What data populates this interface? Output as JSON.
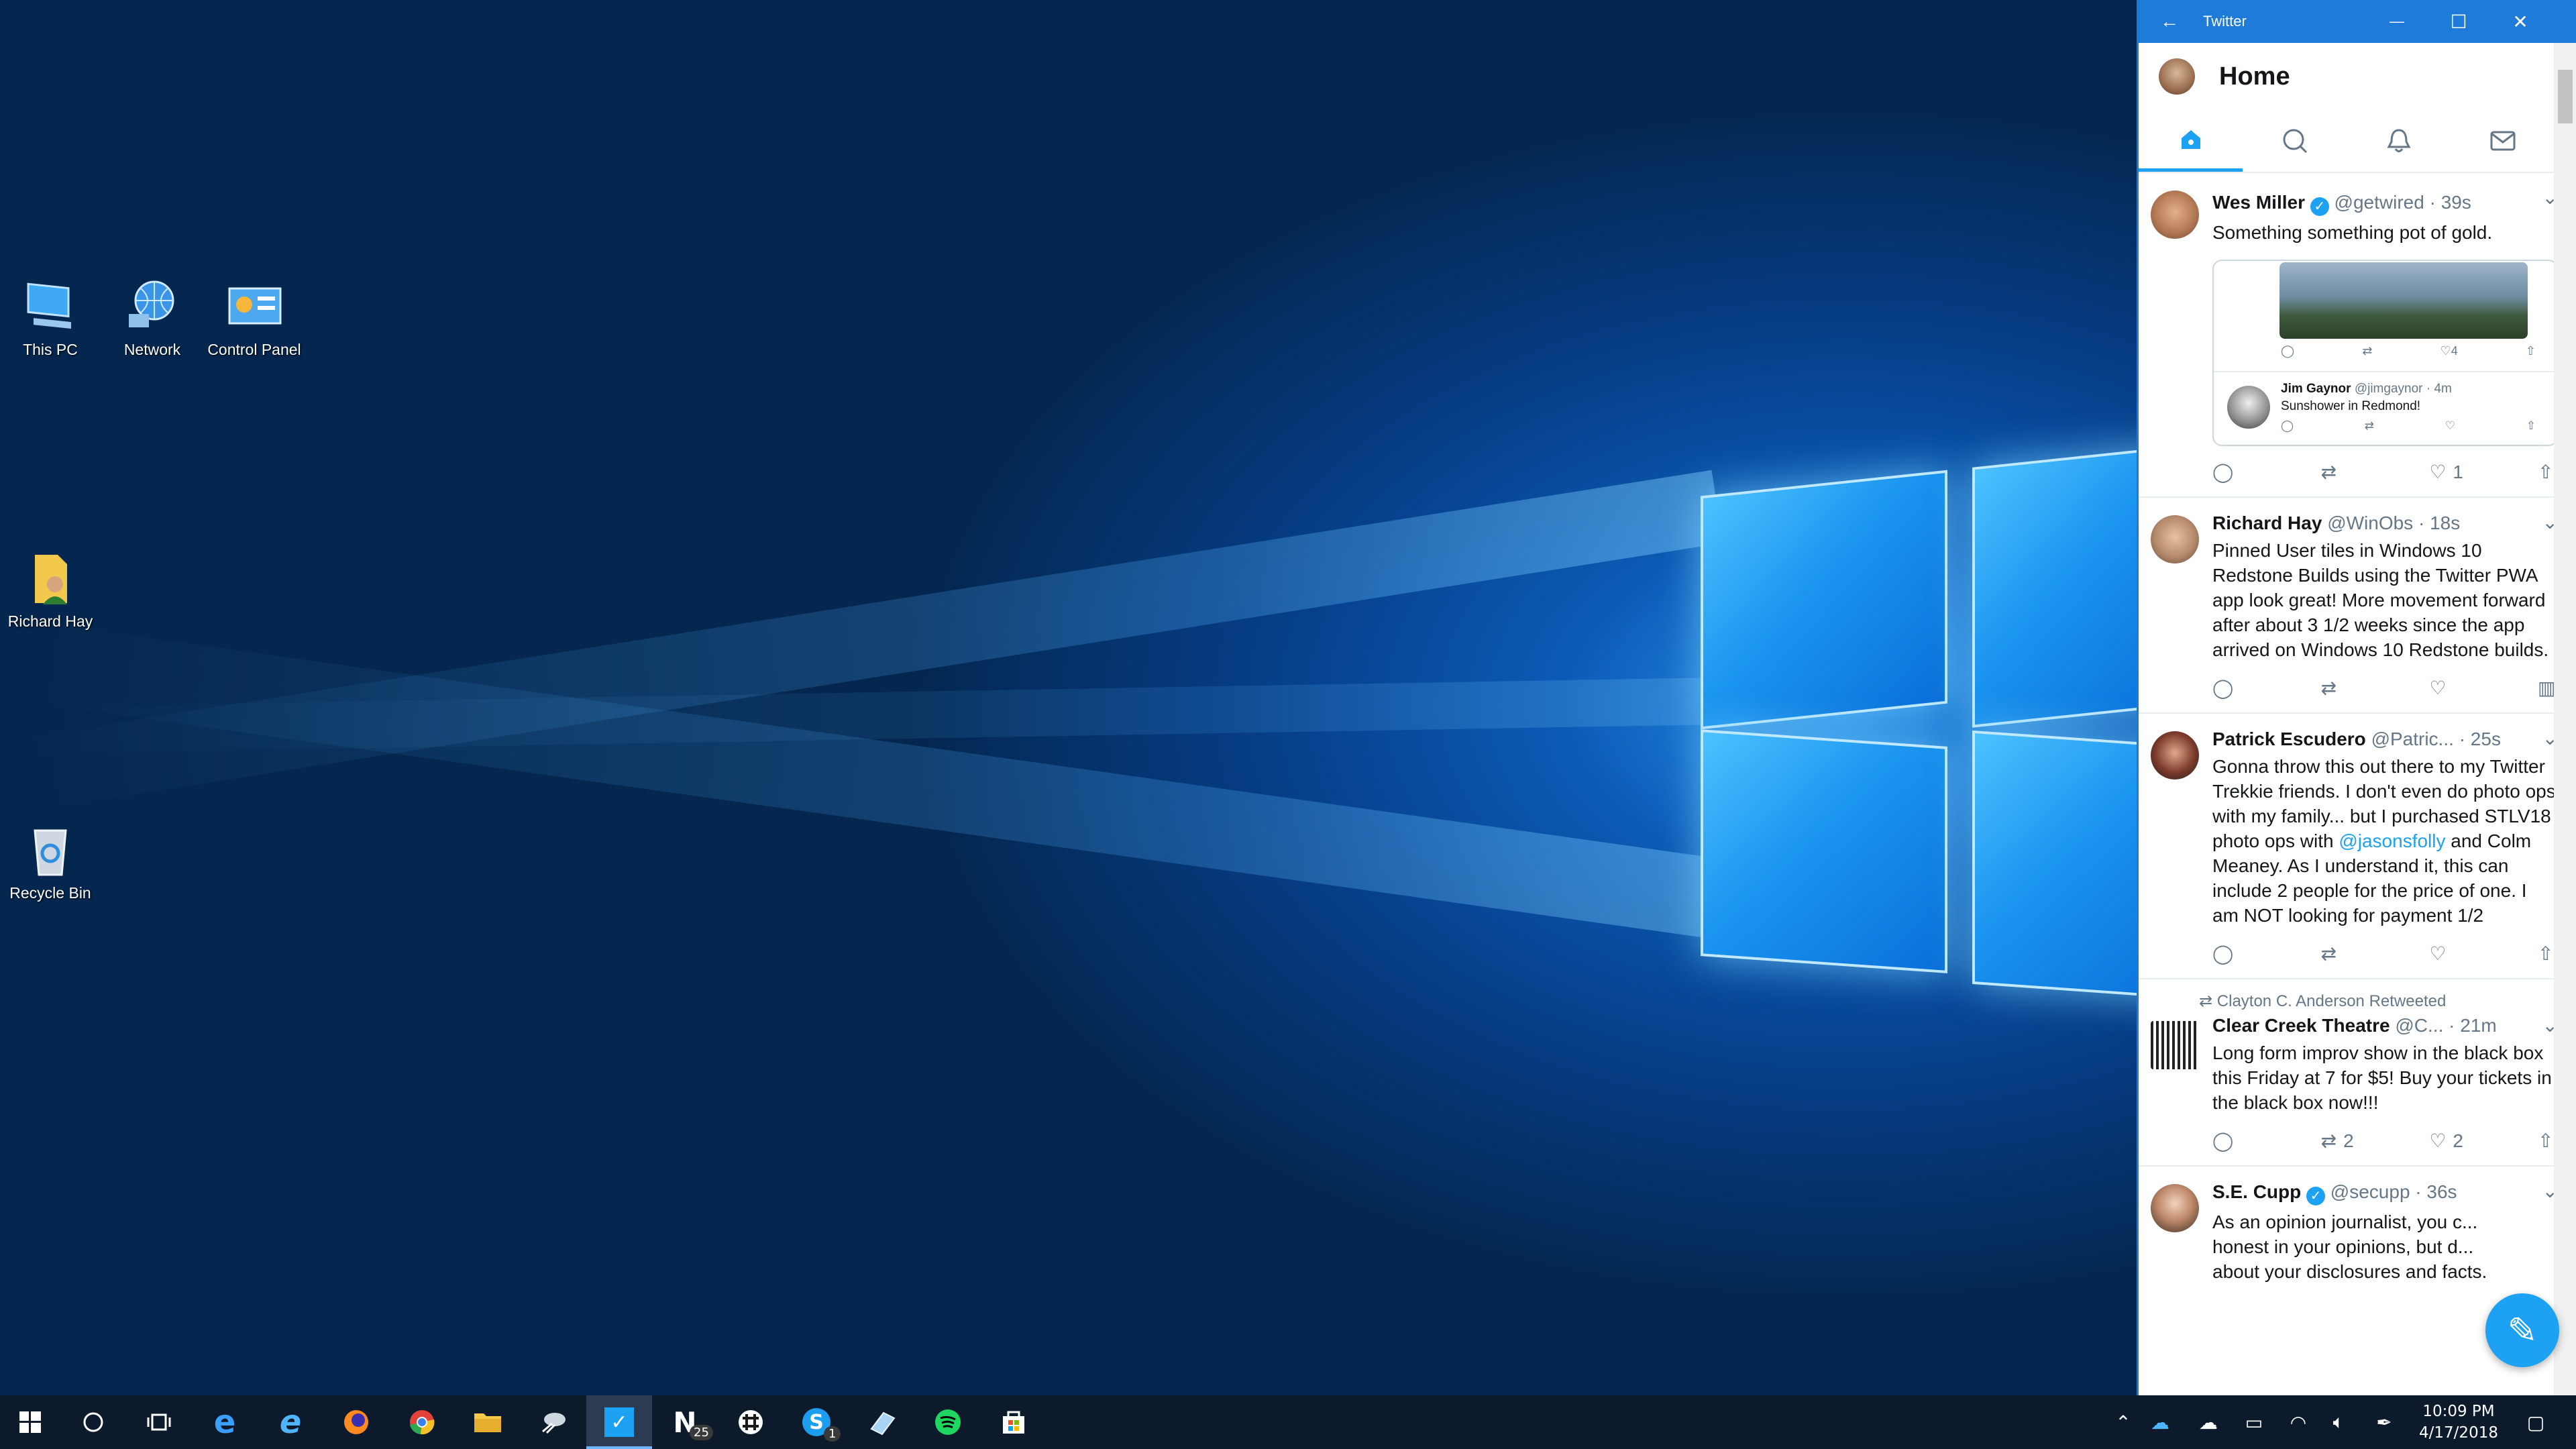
{
  "desktop": {
    "icons": [
      {
        "label": "This PC",
        "icon": "computer-icon"
      },
      {
        "label": "Network",
        "icon": "network-icon"
      },
      {
        "label": "Control Panel",
        "icon": "control-panel-icon"
      },
      {
        "label": "Richard Hay",
        "icon": "user-folder-icon"
      },
      {
        "label": "Recycle Bin",
        "icon": "recycle-bin-icon"
      }
    ]
  },
  "window": {
    "title": "Twitter",
    "back_glyph": "←",
    "minimize_glyph": "—",
    "maximize_glyph": "☐",
    "close_glyph": "✕"
  },
  "twitter": {
    "header_title": "Home",
    "tabs": [
      "home-icon",
      "search-icon",
      "notifications-icon",
      "messages-icon"
    ],
    "tweets": [
      {
        "name": "Wes Miller",
        "handle": "@getwired",
        "sep": "·",
        "time": "39s",
        "text": "Something something pot of gold.",
        "reply_count": "",
        "retweet_count": "",
        "like_count": "1",
        "quote": {
          "like_count": "4",
          "name": "Jim Gaynor",
          "handle": "@jimgaynor",
          "time": "4m",
          "text": "Sunshower in Redmond!"
        }
      },
      {
        "name": "Richard Hay",
        "handle": "@WinObs",
        "sep": "·",
        "time": "18s",
        "text": "Pinned User tiles in Windows 10 Redstone Builds using the Twitter PWA app look great! More movement forward after about 3 1/2 weeks since the app arrived on Windows 10 Redstone builds.",
        "like_count": ""
      },
      {
        "name": "Patrick Escudero",
        "handle": "@Patric...",
        "sep": "·",
        "time": "25s",
        "text_before": "Gonna throw this out there to my Twitter Trekkie friends. I don't even do photo ops with my family... but I purchased STLV18 photo ops with ",
        "mention": "@jasonsfolly",
        "text_after": " and Colm Meaney. As I understand it, this can include 2 people for the price of one. I am NOT looking for payment 1/2"
      },
      {
        "retweeted_by": "Clayton C. Anderson Retweeted",
        "name": "Clear Creek Theatre",
        "handle": "@C...",
        "sep": "·",
        "time": "21m",
        "text": "Long form improv show in the black box this Friday at 7 for $5! Buy your tickets in the black box now!!!",
        "retweet_count": "2",
        "like_count": "2"
      },
      {
        "name": "S.E. Cupp",
        "handle": "@secupp",
        "sep": "·",
        "time": "36s",
        "text": "As an opinion journalist, you c... honest in your opinions, but d... about your disclosures and facts."
      }
    ]
  },
  "taskbar": {
    "apps": [
      "windows-start-icon",
      "cortana-icon",
      "task-view-icon",
      "edge-icon",
      "ie-icon",
      "firefox-icon",
      "chrome-icon",
      "file-explorer-icon",
      "snipping-icon",
      "twitter-icon",
      "news-icon",
      "slack-icon",
      "skype-icon",
      "paint-icon",
      "spotify-icon",
      "store-icon"
    ],
    "news_badge": "25",
    "skype_badge": "1",
    "time": "10:09 PM",
    "date": "4/17/2018"
  },
  "colors": {
    "twitter_blue": "#1da1f2",
    "titlebar_blue": "#1f7bd9",
    "taskbar_bg": "#0c1a2c"
  }
}
